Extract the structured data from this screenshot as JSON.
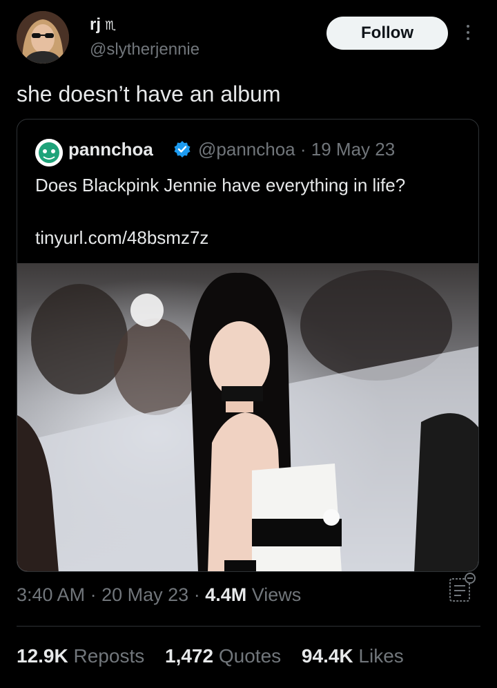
{
  "tweet": {
    "author_name": "rj",
    "author_badge_icon": "ribbon-icon",
    "author_handle": "@slytherjennie",
    "follow_label": "Follow",
    "text": "she doesn’t have an album"
  },
  "quote": {
    "author_name": "pannchoa",
    "author_handle": "@pannchoa",
    "date": "19 May 23",
    "separator": "·",
    "text": "Does Blackpink Jennie have everything in life?",
    "link": "tinyurl.com/48bsmz7z",
    "verified_color": "#1d9bf0"
  },
  "meta": {
    "time": "3:40 AM",
    "date": "20 May 23",
    "separator": "·",
    "views_count": "4.4M",
    "views_label": "Views"
  },
  "stats": {
    "reposts_count": "12.9K",
    "reposts_label": "Reposts",
    "quotes_count": "1,472",
    "quotes_label": "Quotes",
    "likes_count": "94.4K",
    "likes_label": "Likes"
  },
  "colors": {
    "background": "#000000",
    "text": "#e7e9ea",
    "secondary_text": "#71767b",
    "border": "#2f3336"
  }
}
